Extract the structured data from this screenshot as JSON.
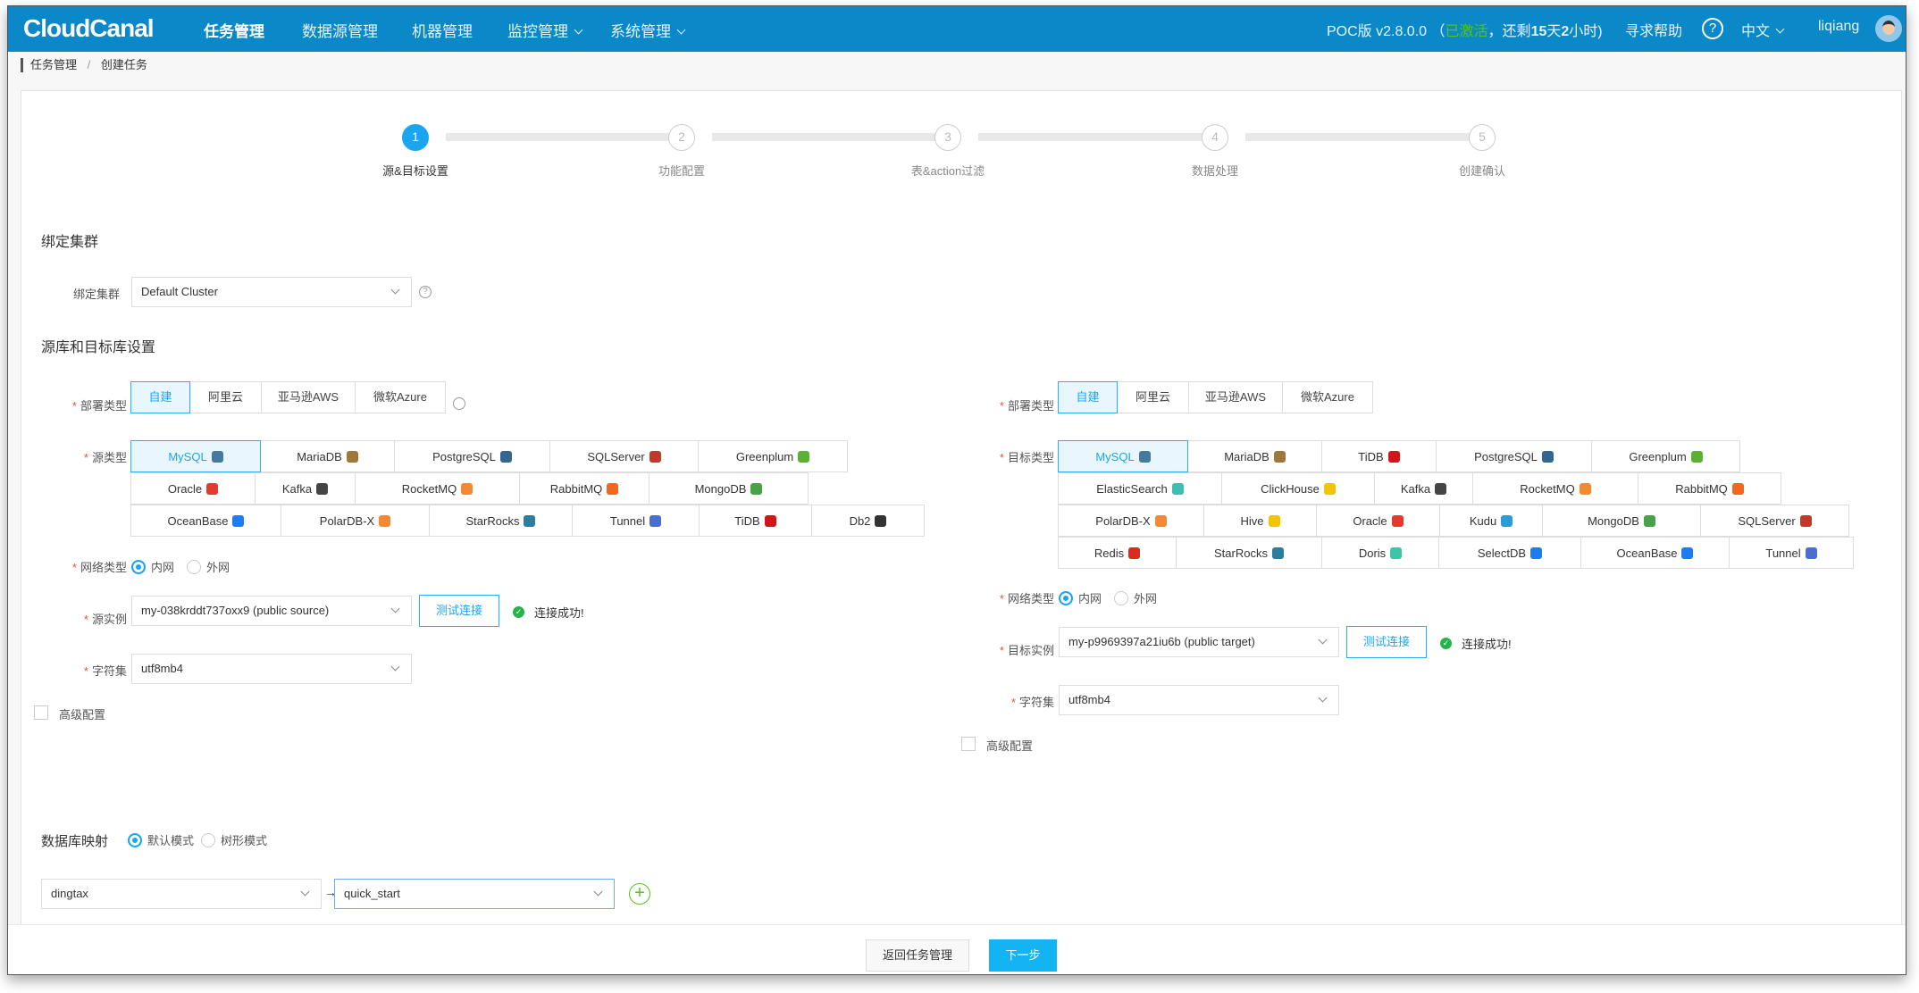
{
  "header": {
    "logo": "CloudCanal",
    "nav": [
      {
        "label": "任务管理",
        "active": true
      },
      {
        "label": "数据源管理"
      },
      {
        "label": "机器管理"
      },
      {
        "label": "监控管理",
        "dropdown": true
      },
      {
        "label": "系统管理",
        "dropdown": true
      }
    ],
    "version": "POC版 v2.8.0.0",
    "status_open": "（",
    "status_active": "已激活",
    "status_rest": "，还剩",
    "days": "15",
    "days_unit": "天",
    "hours": "2",
    "hours_unit": "小时)",
    "help": "寻求帮助",
    "language": "中文",
    "user": "liqiang",
    "active_color": "#52c41a"
  },
  "breadcrumb": {
    "items": [
      "任务管理",
      "创建任务"
    ],
    "sep": "/"
  },
  "steps": [
    {
      "num": "1",
      "label": "源&目标设置",
      "active": true
    },
    {
      "num": "2",
      "label": "功能配置"
    },
    {
      "num": "3",
      "label": "表&action过滤"
    },
    {
      "num": "4",
      "label": "数据处理"
    },
    {
      "num": "5",
      "label": "创建确认"
    }
  ],
  "cluster": {
    "heading": "绑定集群",
    "label": "绑定集群",
    "value": "Default Cluster"
  },
  "dbsection": {
    "heading": "源库和目标库设置"
  },
  "source": {
    "deploy_label": "部署类型",
    "deploy": [
      "自建",
      "阿里云",
      "亚马逊AWS",
      "微软Azure"
    ],
    "type_label": "源类型",
    "types": [
      [
        {
          "n": "MySQL",
          "c": "#4479a1",
          "on": true
        },
        {
          "n": "MariaDB",
          "c": "#a0773a"
        },
        {
          "n": "PostgreSQL",
          "c": "#336791"
        },
        {
          "n": "SQLServer",
          "c": "#c0392b"
        },
        {
          "n": "Greenplum",
          "c": "#5bb131"
        }
      ],
      [
        {
          "n": "Oracle",
          "c": "#e23a2e"
        },
        {
          "n": "Kafka",
          "c": "#444"
        },
        {
          "n": "RocketMQ",
          "c": "#f28a35"
        },
        {
          "n": "RabbitMQ",
          "c": "#f2661f"
        },
        {
          "n": "MongoDB",
          "c": "#47a248"
        }
      ],
      [
        {
          "n": "OceanBase",
          "c": "#1e7bf0"
        },
        {
          "n": "PolarDB-X",
          "c": "#f28a35"
        },
        {
          "n": "StarRocks",
          "c": "#2c7da0"
        },
        {
          "n": "Tunnel",
          "c": "#4a6fd1"
        },
        {
          "n": "TiDB",
          "c": "#d1161b"
        },
        {
          "n": "Db2",
          "c": "#333"
        }
      ]
    ],
    "network_label": "网络类型",
    "network": [
      "内网",
      "外网"
    ],
    "instance_label": "源实例",
    "instance": "my-038krddt737oxx9 (public source)",
    "test": "测试连接",
    "success": "连接成功!",
    "charset_label": "字符集",
    "charset": "utf8mb4",
    "advanced": "高级配置"
  },
  "target": {
    "deploy_label": "部署类型",
    "deploy": [
      "自建",
      "阿里云",
      "亚马逊AWS",
      "微软Azure"
    ],
    "type_label": "目标类型",
    "types": [
      [
        {
          "n": "MySQL",
          "c": "#4479a1",
          "on": true
        },
        {
          "n": "MariaDB",
          "c": "#a0773a"
        },
        {
          "n": "TiDB",
          "c": "#d1161b"
        },
        {
          "n": "PostgreSQL",
          "c": "#336791"
        },
        {
          "n": "Greenplum",
          "c": "#5bb131"
        }
      ],
      [
        {
          "n": "ElasticSearch",
          "c": "#3ebeb0"
        },
        {
          "n": "ClickHouse",
          "c": "#f5c400"
        },
        {
          "n": "Kafka",
          "c": "#444"
        },
        {
          "n": "RocketMQ",
          "c": "#f28a35"
        },
        {
          "n": "RabbitMQ",
          "c": "#f2661f"
        }
      ],
      [
        {
          "n": "PolarDB-X",
          "c": "#f28a35"
        },
        {
          "n": "Hive",
          "c": "#f5c400"
        },
        {
          "n": "Oracle",
          "c": "#e23a2e"
        },
        {
          "n": "Kudu",
          "c": "#2d9bd8"
        },
        {
          "n": "MongoDB",
          "c": "#47a248"
        },
        {
          "n": "SQLServer",
          "c": "#c0392b"
        }
      ],
      [
        {
          "n": "Redis",
          "c": "#d82c20"
        },
        {
          "n": "StarRocks",
          "c": "#2c7da0"
        },
        {
          "n": "Doris",
          "c": "#3ec6a4"
        },
        {
          "n": "SelectDB",
          "c": "#1e7bf0"
        },
        {
          "n": "OceanBase",
          "c": "#1e7bf0"
        },
        {
          "n": "Tunnel",
          "c": "#4a6fd1"
        }
      ]
    ],
    "network_label": "网络类型",
    "network": [
      "内网",
      "外网"
    ],
    "instance_label": "目标实例",
    "instance": "my-p9969397a21iu6b (public target)",
    "test": "测试连接",
    "success": "连接成功!",
    "charset_label": "字符集",
    "charset": "utf8mb4",
    "advanced": "高级配置"
  },
  "mapping": {
    "label": "数据库映射",
    "modes": [
      "默认模式",
      "树形模式"
    ],
    "source_db": "dingtax",
    "target_db": "quick_start"
  },
  "footer": {
    "back": "返回任务管理",
    "next": "下一步"
  },
  "colors": {
    "header": "#0a88c8",
    "primary": "#1aa6ee",
    "success": "#26b34b"
  }
}
